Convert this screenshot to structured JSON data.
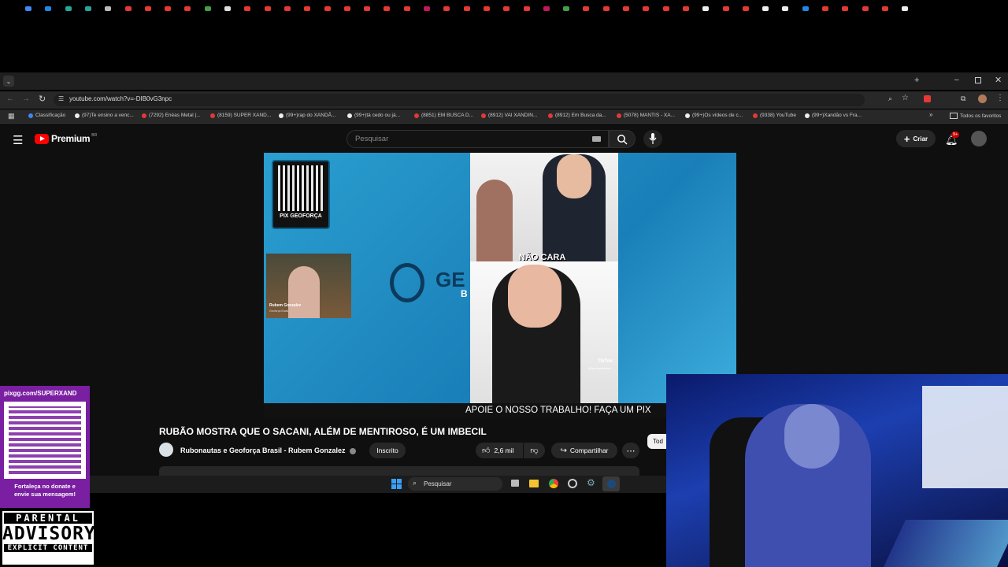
{
  "browser": {
    "url": "youtube.com/watch?v=-DIB0vG3npc",
    "bookmarks": [
      "Classificação",
      "(97)Te ensino a venc...",
      "(7292) Enéas Metal |...",
      "(8159) SUPER XAND...",
      "(99+)rap do XANDÃ...",
      "(99+)tá cedo ou já...",
      "(8851) EM BUSCA D...",
      "(8912) VAI XANDIN...",
      "(8912) Em Busca da...",
      "(5078) MANTIS - XA...",
      "(99+)Os vídeos de c...",
      "(9338) YouTube",
      "(99+)Xandão vs Fra..."
    ],
    "all_bookmarks": "Todos os favoritos"
  },
  "youtube": {
    "logo": "Premium",
    "region": "BR",
    "search_placeholder": "Pesquisar",
    "create": "Criar",
    "notif_count": "9+",
    "video": {
      "qr_label": "PIX GEOFORÇA",
      "host_name": "Rubem Gonzalez",
      "host_sub": "Geoforça Brasil",
      "logo_text": "GE",
      "logo_sub": "B",
      "caption": "NÃO CARA",
      "tiktok": "TikTok",
      "tiktok_handle": "@auriesmindset",
      "banner": "APOIE O NOSSO TRABALHO! FAÇA UM PIX"
    },
    "title": "RUBÃO MOSTRA QUE O SACANI, ALÉM DE MENTIROSO, É UM IMBECIL",
    "channel": "Rubonautas e Geoforça Brasil - Rubem Gonzalez",
    "subscribed": "Inscrito",
    "likes": "2,6 mil",
    "share": "Compartilhar",
    "filter_all": "Tod"
  },
  "taskbar": {
    "search": "Pesquisar"
  },
  "overlay": {
    "pix_url": "pixgg.com/SUPERXAND",
    "pix_text": "Fortaleça no donate e envie sua mensagem!",
    "advisory_1": "PARENTAL",
    "advisory_2": "ADVISORY",
    "advisory_3": "EXPLICIT CONTENT"
  },
  "colors": {
    "yt_red": "#ff0000",
    "pix_purple": "#7b1fa2",
    "video_blue": "#2a9fd0"
  }
}
